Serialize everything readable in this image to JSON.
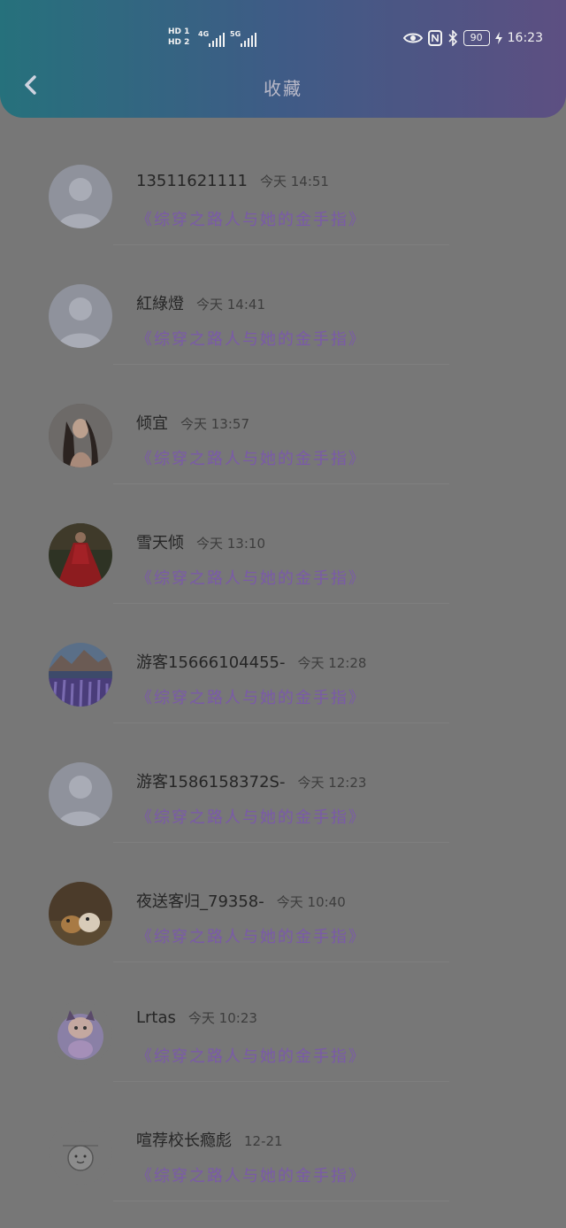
{
  "status_bar": {
    "hd1": "HD 1",
    "hd2": "HD 2",
    "sig1_label": "4G",
    "sig2_label": "5G",
    "battery": "90",
    "time": "16:23"
  },
  "header": {
    "title": "收藏"
  },
  "items": [
    {
      "user": "13511621111",
      "time": "今天 14:51",
      "book": "《综穿之路人与她的金手指》",
      "avatar": "default"
    },
    {
      "user": "紅綠燈",
      "time": "今天 14:41",
      "book": "《综穿之路人与她的金手指》",
      "avatar": "default"
    },
    {
      "user": "倾宜",
      "time": "今天 13:57",
      "book": "《综穿之路人与她的金手指》",
      "avatar": "photo-woman"
    },
    {
      "user": "雪天倾",
      "time": "今天 13:10",
      "book": "《综穿之路人与她的金手指》",
      "avatar": "photo-red-dress"
    },
    {
      "user": "游客15666104455-",
      "time": "今天 12:28",
      "book": "《综穿之路人与她的金手指》",
      "avatar": "photo-lupine"
    },
    {
      "user": "游客1586158372S-",
      "time": "今天 12:23",
      "book": "《综穿之路人与她的金手指》",
      "avatar": "default"
    },
    {
      "user": "夜送客归_79358-",
      "time": "今天 10:40",
      "book": "《综穿之路人与她的金手指》",
      "avatar": "photo-dogs"
    },
    {
      "user": "Lrtas",
      "time": "今天 10:23",
      "book": "《综穿之路人与她的金手指》",
      "avatar": "anime"
    },
    {
      "user": "喧荐校长瘾彪",
      "time": "12-21",
      "book": "《综穿之路人与她的金手指》",
      "avatar": "sketch"
    }
  ],
  "colors": {
    "header_start": "#26717c",
    "header_end": "#5d4f82",
    "book_link": "#7a5aa8",
    "overlay_bg": "#777777"
  }
}
